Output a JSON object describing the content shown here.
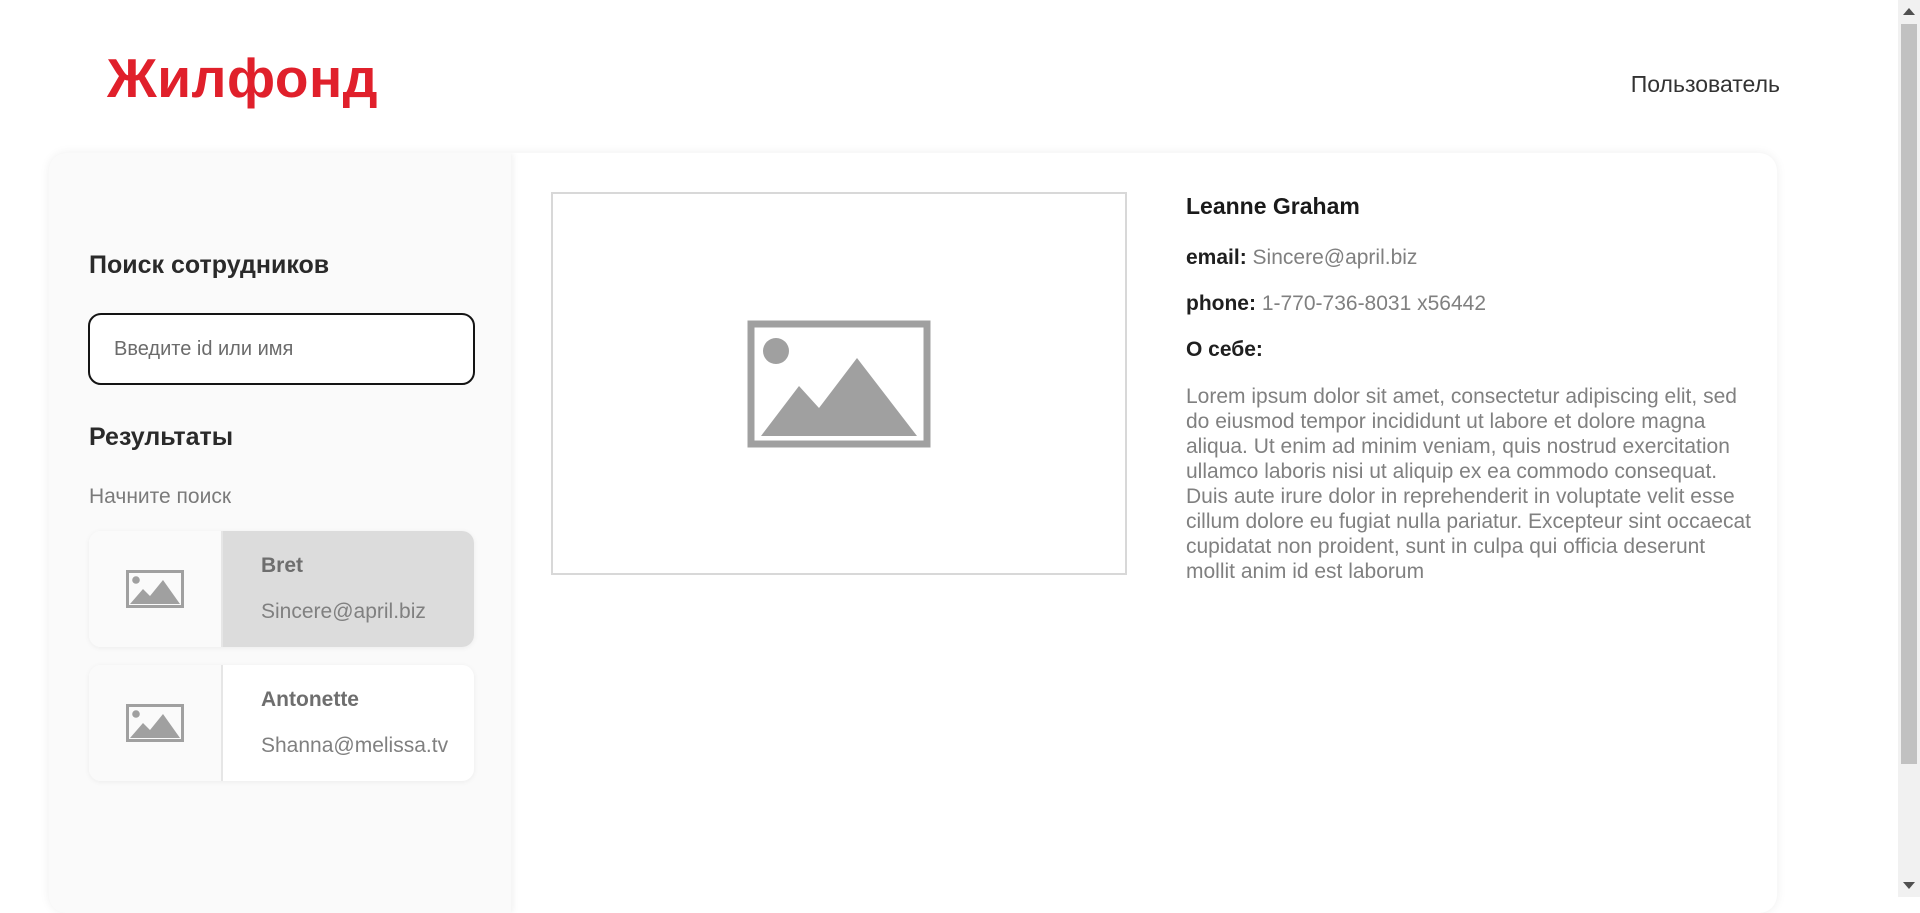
{
  "header": {
    "logo": "Жилфонд",
    "user_link": "Пользователь"
  },
  "sidebar": {
    "search_title": "Поиск сотрудников",
    "search_placeholder": "Введите id или имя",
    "search_value": "",
    "results_title": "Результаты",
    "hint": "Начните поиск",
    "results": [
      {
        "name": "Bret",
        "email": "Sincere@april.biz",
        "active": true,
        "icon": "image-placeholder-icon"
      },
      {
        "name": "Antonette",
        "email": "Shanna@melissa.tv",
        "active": false,
        "icon": "image-placeholder-icon"
      }
    ]
  },
  "profile": {
    "photo_icon": "image-placeholder-icon",
    "name": "Leanne Graham",
    "email_label": "email:",
    "email": "Sincere@april.biz",
    "phone_label": "phone:",
    "phone": "1-770-736-8031 x56442",
    "about_label": "О себе:",
    "about": "Lorem ipsum dolor sit amet, consectetur adipiscing elit, sed do eiusmod tempor incididunt ut labore et dolore magna aliqua. Ut enim ad minim veniam, quis nostrud exercitation ullamco laboris nisi ut aliquip ex ea commodo consequat. Duis aute irure dolor in reprehenderit in voluptate velit esse cillum dolore eu fugiat nulla pariatur. Excepteur sint occaecat cupidatat non proident, sunt in culpa qui officia deserunt mollit anim id est laborum"
  },
  "colors": {
    "brand": "#e0202b",
    "active_result": "#dcdcdc",
    "placeholder_icon": "#a0a0a0"
  }
}
